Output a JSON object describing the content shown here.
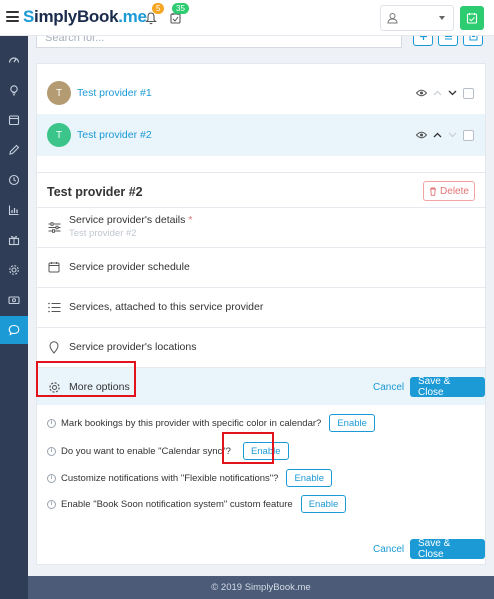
{
  "brand": {
    "logo_s": "S",
    "logo_text": "implyBook",
    "logo_tld": ".me"
  },
  "header": {
    "notifications_badge": "5",
    "tasks_badge": "35",
    "badge_colors": {
      "notifications": "#f5a623",
      "tasks": "#2ecc71"
    }
  },
  "search": {
    "placeholder": "Search for..."
  },
  "providers": [
    {
      "initial": "T",
      "name": "Test provider #1",
      "avatar_color": "#b59b72",
      "selected": false
    },
    {
      "initial": "T",
      "name": "Test provider #2",
      "avatar_color": "#3cc58a",
      "selected": true
    }
  ],
  "detail": {
    "title": "Test provider #2",
    "delete_label": "Delete",
    "rows": {
      "details_label": "Service provider's details",
      "details_required": "*",
      "details_sub": "Test provider #2",
      "schedule_label": "Service provider schedule",
      "services_label": "Services, attached to this service provider",
      "locations_label": "Service provider's locations",
      "more_label": "More options"
    },
    "cancel_label": "Cancel",
    "save_close_label": "Save & Close",
    "features": [
      {
        "text": "Mark bookings by this provider with specific color in calendar?",
        "button": "Enable"
      },
      {
        "text": "Do you want to enable \"Calendar sync\"?",
        "button": "Enable"
      },
      {
        "text": "Customize notifications with \"Flexible notifications\"?",
        "button": "Enable"
      },
      {
        "text": "Enable \"Book Soon notification system\" custom feature",
        "button": "Enable"
      }
    ]
  },
  "footer": {
    "copyright": "© 2019 SimplyBook.me"
  },
  "colors": {
    "accent": "#1b9ad6",
    "sidebar": "#2f3d56",
    "highlight": "#e3131b",
    "footer": "#4b5b78"
  }
}
